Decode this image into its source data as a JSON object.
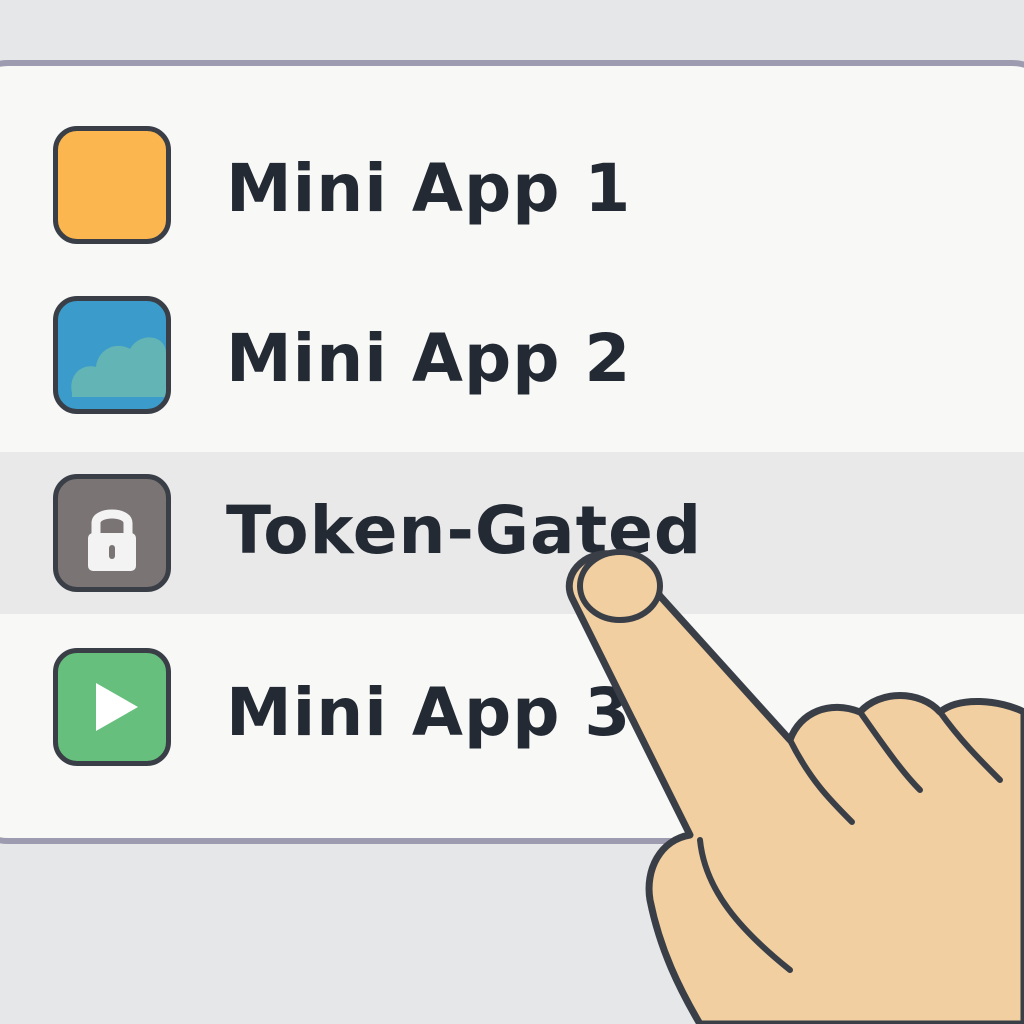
{
  "app_list": {
    "items": [
      {
        "label": "Mini App 1",
        "icon": "orange-square-icon",
        "icon_color": "#fbb64f"
      },
      {
        "label": "Mini App 2",
        "icon": "cloud-icon",
        "icon_color": "#3b9ccb"
      },
      {
        "label": "Token-Gated",
        "icon": "lock-icon",
        "icon_color": "#7a7474",
        "highlighted": true
      },
      {
        "label": "Mini App 3",
        "icon": "play-icon",
        "icon_color": "#66bf7c"
      }
    ]
  },
  "colors": {
    "background": "#e6e7e9",
    "panel": "#f8f8f6",
    "panel_border": "#9d9bb0",
    "highlight_row": "#e9e9e9",
    "text": "#232a33",
    "skin": "#f2cfa0"
  }
}
